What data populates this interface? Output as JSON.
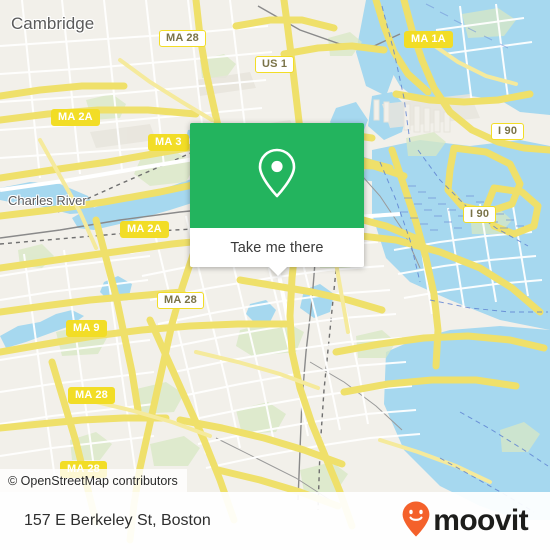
{
  "map": {
    "place_labels": [
      {
        "name": "cambridge",
        "text": "Cambridge"
      },
      {
        "name": "charles-river",
        "text": "Charles River"
      }
    ],
    "route_shields": [
      {
        "name": "ma-28-north",
        "text": "MA 28",
        "style": "white"
      },
      {
        "name": "us-1",
        "text": "US 1",
        "style": "white"
      },
      {
        "name": "ma-1a",
        "text": "MA 1A",
        "style": "yellow"
      },
      {
        "name": "ma-2a-upper",
        "text": "MA 2A",
        "style": "yellow"
      },
      {
        "name": "ma-3",
        "text": "MA 3",
        "style": "yellow"
      },
      {
        "name": "i-90-upper",
        "text": "I 90",
        "style": "white"
      },
      {
        "name": "i-90-lower",
        "text": "I 90",
        "style": "white"
      },
      {
        "name": "ma-2a-lower",
        "text": "MA 2A",
        "style": "yellow"
      },
      {
        "name": "ma-28-mid",
        "text": "MA 28",
        "style": "white"
      },
      {
        "name": "ma-9",
        "text": "MA 9",
        "style": "yellow"
      },
      {
        "name": "ma-28-sw",
        "text": "MA 28",
        "style": "yellow"
      },
      {
        "name": "ma-28-south",
        "text": "MA 28",
        "style": "yellow"
      }
    ],
    "attribution": "© OpenStreetMap contributors",
    "colors": {
      "water": "#a6d8ef",
      "land": "#f2f0ea",
      "park": "#d6e9c2",
      "road_major": "#f7e06e",
      "road_minor": "#ffffff",
      "shield_yellow": "#f2dd26"
    }
  },
  "popup": {
    "icon": "map-pin-icon",
    "action_label": "Take me there",
    "accent_color": "#23b45e"
  },
  "footer": {
    "address": "157 E Berkeley St, Boston",
    "brand_name": "moovit",
    "brand_icon": "moovit-smiley-pin-icon",
    "brand_color": "#f4612b"
  }
}
